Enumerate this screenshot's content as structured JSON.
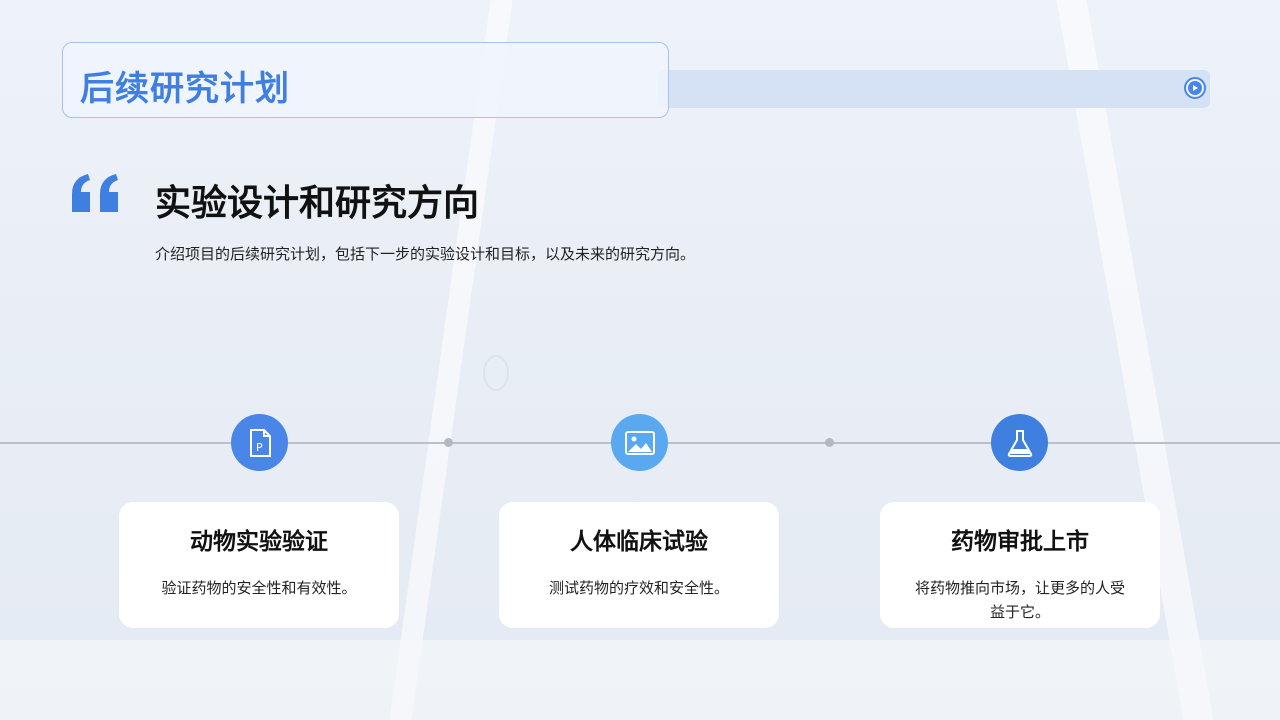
{
  "header": {
    "title": "后续研究计划"
  },
  "section": {
    "heading": "实验设计和研究方向",
    "description": "介绍项目的后续研究计划，包括下一步的实验设计和目标，以及未来的研究方向。"
  },
  "steps": [
    {
      "icon": "powerpoint-file-icon",
      "title": "动物实验验证",
      "text": "验证药物的安全性和有效性。"
    },
    {
      "icon": "image-icon",
      "title": "人体临床试验",
      "text": "测试药物的疗效和安全性。"
    },
    {
      "icon": "flask-icon",
      "title": "药物审批上市",
      "text": "将药物推向市场，让更多的人受益于它。"
    }
  ],
  "colors": {
    "accent": "#3f7fe0",
    "step_1": "#4a86e8",
    "step_2": "#5aa9f0",
    "step_3": "#3f7fe0"
  }
}
